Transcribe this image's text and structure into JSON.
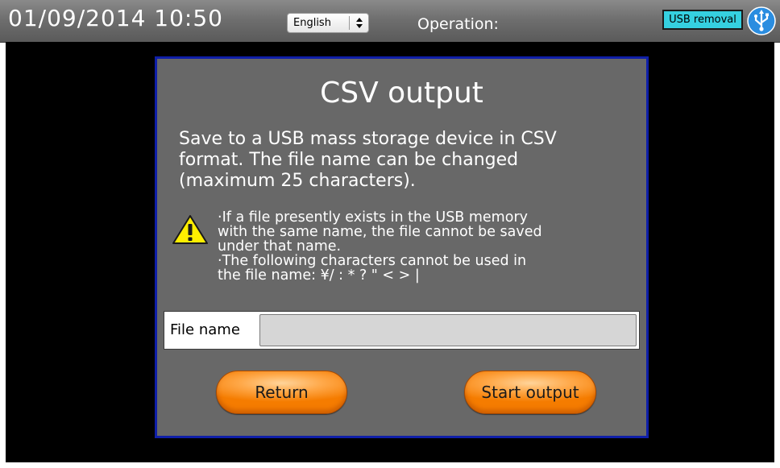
{
  "header": {
    "datetime": "01/09/2014  10:50",
    "language": {
      "selected": "English",
      "icon": "select-arrows-icon"
    },
    "operation_label": "Operation:",
    "usb_removal_label": "USB removal",
    "usb_icon": "usb-icon"
  },
  "dialog": {
    "title": "CSV output",
    "description": "Save to a USB mass storage device in CSV\nformat. The file name can be changed\n (maximum 25 characters).",
    "warning": {
      "icon": "warning-icon",
      "text": "·If a file presently exists in the USB memory\nwith the same name, the file cannot be saved\nunder that name.\n·The following characters cannot be used in\nthe file name: ¥/ : * ? \" < > |"
    },
    "file_name": {
      "label": "File name",
      "value": "",
      "placeholder": ""
    },
    "return_label": "Return",
    "start_output_label": "Start output"
  },
  "colors": {
    "dialog_border": "#0f1fa8",
    "dialog_bg": "#686868",
    "button_orange": "#f57c00",
    "usb_removal_bg": "#35d0e0",
    "usb_icon_bg": "#2a8de0"
  }
}
